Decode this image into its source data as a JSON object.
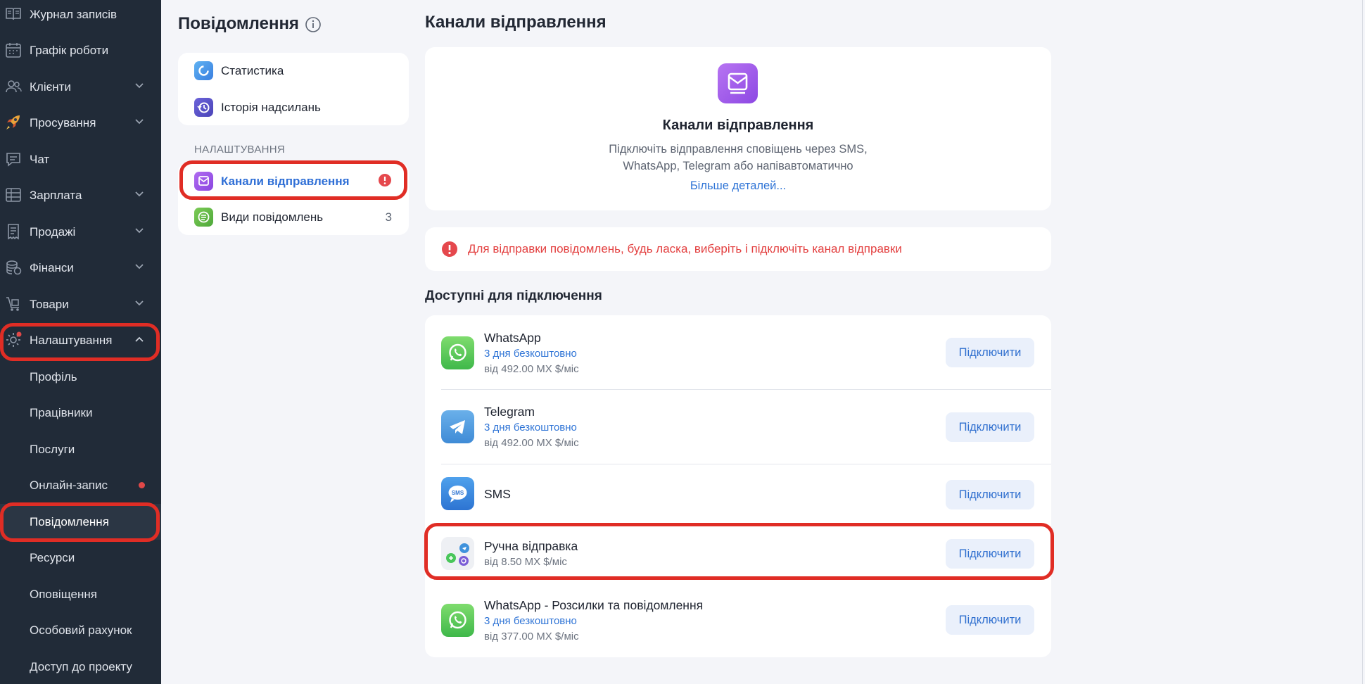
{
  "sidebar": {
    "items": [
      {
        "label": "Журнал записів",
        "icon": "journal-icon"
      },
      {
        "label": "Графік роботи",
        "icon": "calendar-icon"
      },
      {
        "label": "Клієнти",
        "icon": "clients-icon",
        "expandable": true
      },
      {
        "label": "Просування",
        "icon": "rocket-icon",
        "expandable": true
      },
      {
        "label": "Чат",
        "icon": "chat-icon"
      },
      {
        "label": "Зарплата",
        "icon": "salary-icon",
        "expandable": true
      },
      {
        "label": "Продажі",
        "icon": "sales-icon",
        "expandable": true
      },
      {
        "label": "Фінанси",
        "icon": "finance-icon",
        "expandable": true
      },
      {
        "label": "Товари",
        "icon": "goods-icon",
        "expandable": true
      },
      {
        "label": "Налаштування",
        "icon": "settings-icon",
        "expanded": true
      }
    ],
    "sub_items": [
      {
        "label": "Профіль"
      },
      {
        "label": "Працівники"
      },
      {
        "label": "Послуги"
      },
      {
        "label": "Онлайн-запис",
        "has_dot": true
      },
      {
        "label": "Повідомлення",
        "active": true
      },
      {
        "label": "Ресурси"
      },
      {
        "label": "Оповіщення"
      },
      {
        "label": "Особовий рахунок"
      },
      {
        "label": "Доступ до проекту"
      }
    ]
  },
  "messages_menu": {
    "title": "Повідомлення",
    "top_items": [
      {
        "label": "Статистика",
        "icon": "statistics-icon"
      },
      {
        "label": "Історія надсилань",
        "icon": "history-icon"
      }
    ],
    "section_caption": "НАЛАШТУВАННЯ",
    "settings_items": [
      {
        "label": "Канали відправлення",
        "icon": "channels-icon",
        "active": true,
        "alert": true
      },
      {
        "label": "Види повідомлень",
        "icon": "message-types-icon",
        "count": "3"
      }
    ]
  },
  "main": {
    "title": "Канали відправлення",
    "hero": {
      "title": "Канали відправлення",
      "description_line1": "Підключіть відправлення сповіщень через SMS,",
      "description_line2": "WhatsApp, Telegram або напівавтоматично",
      "link": "Більше деталей..."
    },
    "warning": "Для відправки повідомлень, будь ласка, виберіть і підключіть канал відправки",
    "available_title": "Доступні для підключення",
    "channels": [
      {
        "name": "WhatsApp",
        "trial": "3 дня безкоштовно",
        "price": "від 492.00 MX $/міс",
        "button": "Підключити",
        "icon": "whatsapp-icon"
      },
      {
        "name": "Telegram",
        "trial": "3 дня безкоштовно",
        "price": "від 492.00 MX $/міс",
        "button": "Підключити",
        "icon": "telegram-icon"
      },
      {
        "name": "SMS",
        "button": "Підключити",
        "icon": "sms-icon",
        "icon_text": "SMS"
      },
      {
        "name": "Ручна відправка",
        "price": "від 8.50 MX $/міс",
        "button": "Підключити",
        "icon": "manual-send-icon"
      },
      {
        "name": "WhatsApp - Розсилки та повідомлення",
        "trial": "3 дня безкоштовно",
        "price": "від 377.00 MX $/міс",
        "button": "Підключити",
        "icon": "whatsapp-icon"
      }
    ]
  },
  "colors": {
    "sidebar_bg": "#212b38",
    "accent_blue": "#2f74d6",
    "alert_red": "#e34040",
    "highlight_ring": "#e02d25",
    "channels_purple": "#9b5de5"
  }
}
